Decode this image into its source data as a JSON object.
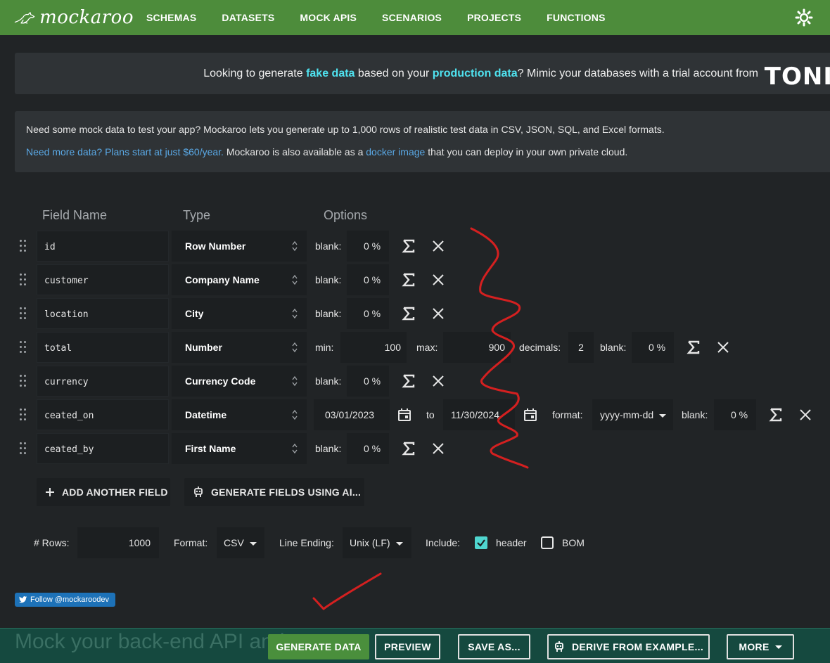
{
  "nav": {
    "logo_text": "mockaroo",
    "links": [
      "SCHEMAS",
      "DATASETS",
      "MOCK APIS",
      "SCENARIOS",
      "PROJECTS",
      "FUNCTIONS"
    ]
  },
  "banner": {
    "t1": "Looking to generate ",
    "hl1": "fake data",
    "t2": " based on your ",
    "hl2": "production data",
    "t3": "? Mimic your databases with a trial account from",
    "brand": "TONI"
  },
  "info": {
    "line1": "Need some mock data to test your app? Mockaroo lets you generate up to 1,000 rows of realistic test data in CSV, JSON, SQL, and Excel formats.",
    "link1": "Need more data? Plans start at just $60/year.",
    "mid": " Mockaroo is also available as a ",
    "link2": "docker image",
    "tail": " that you can deploy in your own private cloud."
  },
  "columns": {
    "name": "Field Name",
    "type": "Type",
    "options": "Options"
  },
  "fields": [
    {
      "name": "id",
      "type": "Row Number",
      "blank_label": "blank:",
      "blank": "0 %"
    },
    {
      "name": "customer",
      "type": "Company Name",
      "blank_label": "blank:",
      "blank": "0 %"
    },
    {
      "name": "location",
      "type": "City",
      "blank_label": "blank:",
      "blank": "0 %"
    },
    {
      "name": "total",
      "type": "Number",
      "min_label": "min:",
      "min": "100",
      "max_label": "max:",
      "max": "900",
      "decimals_label": "decimals:",
      "decimals": "2",
      "blank_label": "blank:",
      "blank": "0 %"
    },
    {
      "name": "currency",
      "type": "Currency Code",
      "blank_label": "blank:",
      "blank": "0 %"
    },
    {
      "name": "ceated_on",
      "type": "Datetime",
      "from": "03/01/2023",
      "to_label": "to",
      "to": "11/30/2024",
      "format_label": "format:",
      "format": "yyyy-mm-dd",
      "blank_label": "blank:",
      "blank": "0 %"
    },
    {
      "name": "ceated_by",
      "type": "First Name",
      "blank_label": "blank:",
      "blank": "0 %"
    }
  ],
  "actions": {
    "add_field": "ADD ANOTHER FIELD",
    "generate_ai": "GENERATE FIELDS USING AI..."
  },
  "settings": {
    "rows_label": "# Rows:",
    "rows": "1000",
    "format_label": "Format:",
    "format": "CSV",
    "line_ending_label": "Line Ending:",
    "line_ending": "Unix (LF)",
    "include_label": "Include:",
    "header_label": "header",
    "header_checked": true,
    "bom_label": "BOM",
    "bom_checked": false
  },
  "twitter": {
    "label": "Follow @mockaroodev"
  },
  "footer": {
    "ghost_text": "Mock your back-end API and",
    "generate": "GENERATE DATA",
    "preview": "PREVIEW",
    "save_as": "SAVE AS...",
    "derive": "DERIVE FROM EXAMPLE...",
    "more": "MORE"
  },
  "colors": {
    "nav_green": "#4d8c3b",
    "accent_cyan": "#4fe3f0",
    "footer_teal": "#15493f",
    "annotation_red": "#d42020"
  }
}
